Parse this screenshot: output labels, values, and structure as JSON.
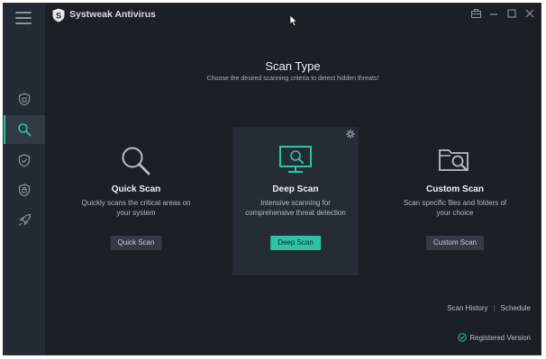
{
  "window": {
    "app_title": "Systweak Antivirus"
  },
  "sidebar": {
    "items": [
      {
        "name": "status",
        "icon": "shield-home-icon"
      },
      {
        "name": "scan",
        "icon": "search-icon",
        "active": true
      },
      {
        "name": "protection",
        "icon": "shield-check-icon"
      },
      {
        "name": "web-security",
        "icon": "shield-lock-icon"
      },
      {
        "name": "startup-manager",
        "icon": "rocket-icon"
      }
    ]
  },
  "main": {
    "title": "Scan Type",
    "subtitle": "Choose the desired scanning criteria to detect hidden threats!",
    "cards": [
      {
        "title": "Quick Scan",
        "description": "Quickly scans the critical areas on your system",
        "button": "Quick Scan",
        "icon": "magnifier-icon"
      },
      {
        "title": "Deep Scan",
        "description": "Intensive scanning for comprehensive threat detection",
        "button": "Deep Scan",
        "icon": "monitor-scan-icon"
      },
      {
        "title": "Custom Scan",
        "description": "Scan specific files and folders of your choice",
        "button": "Custom Scan",
        "icon": "folder-scan-icon"
      }
    ]
  },
  "footer": {
    "scan_history": "Scan History",
    "separator": "|",
    "schedule": "Schedule",
    "registered": "Registered Version"
  },
  "colors": {
    "accent": "#2fc3a5",
    "background": "#1b1f26",
    "sidebar": "#242a33"
  }
}
